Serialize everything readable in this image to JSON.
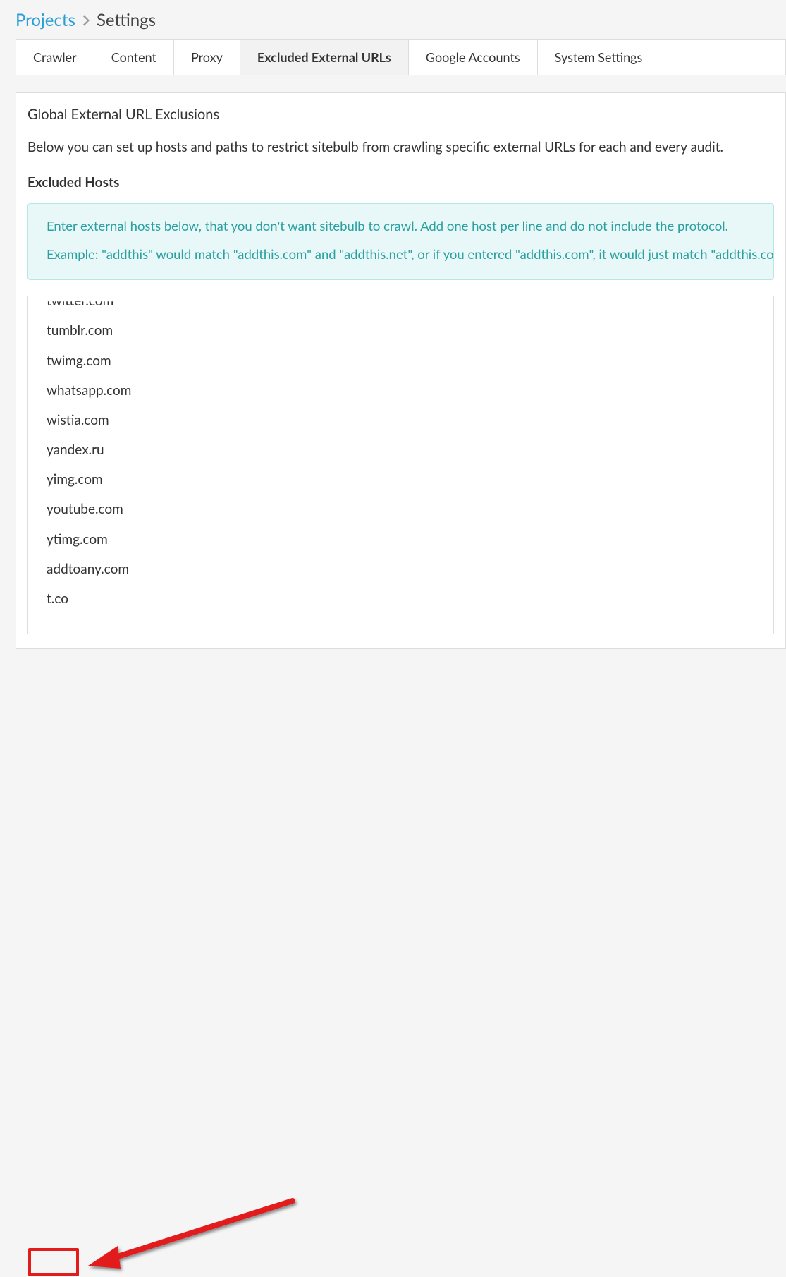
{
  "breadcrumb": {
    "parent": "Projects",
    "current": "Settings"
  },
  "tabs": [
    {
      "label": "Crawler",
      "active": false
    },
    {
      "label": "Content",
      "active": false
    },
    {
      "label": "Proxy",
      "active": false
    },
    {
      "label": "Excluded External URLs",
      "active": true
    },
    {
      "label": "Google Accounts",
      "active": false
    },
    {
      "label": "System Settings",
      "active": false
    }
  ],
  "panel": {
    "title": "Global External URL Exclusions",
    "description": "Below you can set up hosts and paths to restrict sitebulb from crawling specific external URLs for each and every audit.",
    "section_label": "Excluded Hosts",
    "info_line1": "Enter external hosts below, that you don't want sitebulb to crawl. Add one host per line and do not include the protocol.",
    "info_line2": "Example: \"addthis\" would match \"addthis.com\" and \"addthis.net\", or if you entered \"addthis.com\", it would just match \"addthis.com\"."
  },
  "excluded_hosts": [
    "twitter.com",
    "tumblr.com",
    "twimg.com",
    "whatsapp.com",
    "wistia.com",
    "yandex.ru",
    "yimg.com",
    "youtube.com",
    "ytimg.com",
    "addtoany.com",
    "t.co"
  ],
  "annotation": {
    "highlighted_host": "t.co"
  }
}
